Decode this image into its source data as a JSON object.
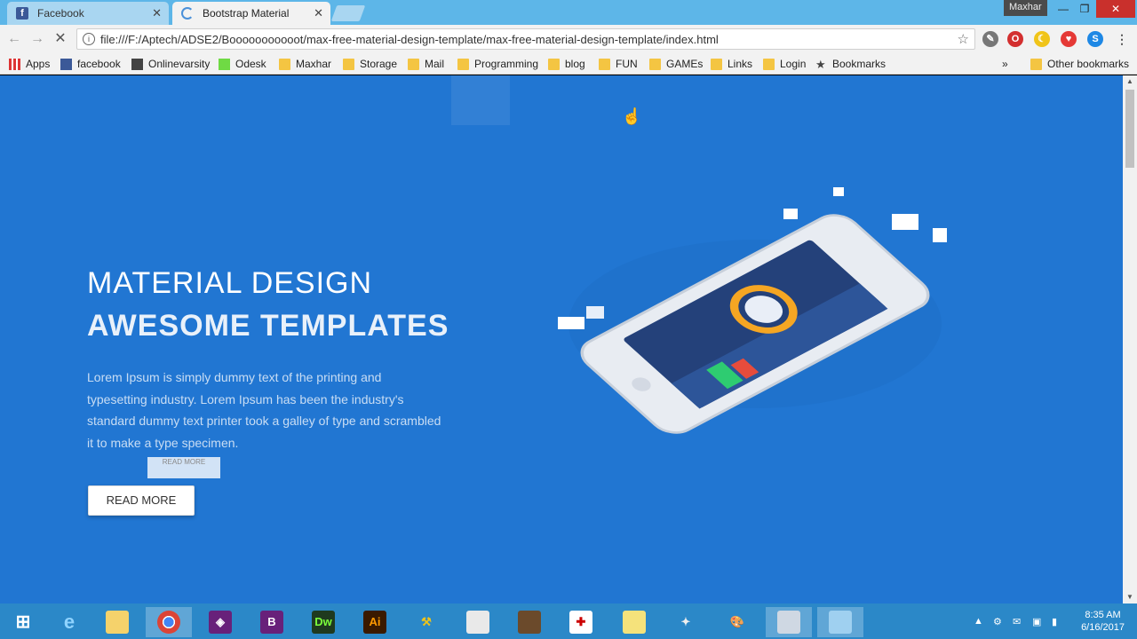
{
  "browser": {
    "tabs": [
      {
        "label": "Facebook",
        "active": false
      },
      {
        "label": "Bootstrap Material",
        "active": true
      }
    ],
    "profile_name": "Maxhar",
    "url": "file:///F:/Aptech/ADSE2/Booooooooooot/max-free-material-design-template/max-free-material-design-template/index.html",
    "bookmarks": [
      "Apps",
      "facebook",
      "Onlinevarsity",
      "Odesk",
      "Maxhar",
      "Storage",
      "Mail",
      "Programming",
      "blog",
      "FUN",
      "GAMEs",
      "Links",
      "Login",
      "Bookmarks"
    ],
    "more_bookmarks": "»",
    "other_bookmarks": "Other bookmarks"
  },
  "hero": {
    "title_line1": "MATERIAL DESIGN",
    "title_line2": "AWESOME TEMPLATES",
    "body": "Lorem Ipsum is simply dummy text of the printing and typesetting industry. Lorem Ipsum has been the industry's standard dummy text printer took a galley of type and scrambled it to make a type specimen.",
    "button_label": "READ MORE",
    "ghost_button_label": "READ MORE"
  },
  "taskbar": {
    "apps": [
      "windows-start",
      "internet-explorer",
      "file-explorer",
      "chrome",
      "visual-studio",
      "visual-studio-blend",
      "Dw",
      "Ai",
      "tools",
      "notepad",
      "game",
      "shield",
      "folder",
      "paint",
      "palette",
      "snipping",
      "window"
    ],
    "dw_label": "Dw",
    "ai_label": "Ai",
    "time": "8:35 AM",
    "date": "6/16/2017"
  },
  "colors": {
    "page_bg": "#2176d2",
    "titlebar": "#5db6e8",
    "taskbar": "#2b88c8"
  }
}
